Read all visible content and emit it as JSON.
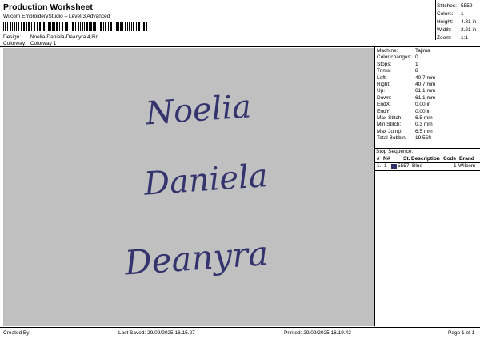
{
  "header": {
    "title": "Production Worksheet",
    "subtitle": "Wilcom EmbroideryStudio – Level 3 Advanced",
    "design_label": "Design:",
    "design_value": "Noelia-Daniela-Deanyra 4,8in",
    "colorway_label": "Colorway:",
    "colorway_value": "Colorway 1"
  },
  "summary": {
    "stitches_label": "Stitches:",
    "stitches_value": "5559",
    "colors_label": "Colors:",
    "colors_value": "1",
    "height_label": "Height:",
    "height_value": "4.81 in",
    "width_label": "Width:",
    "width_value": "3.21 in",
    "zoom_label": "Zoom:",
    "zoom_value": "1:1"
  },
  "design": {
    "names": [
      "Noelia",
      "Daniela",
      "Deanyra"
    ],
    "thread_color": "#35336e",
    "background_color": "#c0c0c0"
  },
  "machine_info": {
    "machine_label": "Machine:",
    "machine_value": "Tajima",
    "color_changes_label": "Color changes:",
    "color_changes_value": "0",
    "stops_label": "Stops:",
    "stops_value": "1",
    "trims_label": "Trims:",
    "trims_value": "8",
    "left_label": "Left:",
    "left_value": "40.7 mm",
    "right_label": "Right:",
    "right_value": "40.7 mm",
    "up_label": "Up:",
    "up_value": "61.1 mm",
    "down_label": "Down:",
    "down_value": "61.1 mm",
    "endx_label": "EndX:",
    "endx_value": "0.00 in",
    "endy_label": "EndY:",
    "endy_value": "0.00 in",
    "max_stitch_label": "Max Stitch:",
    "max_stitch_value": "6.5 mm",
    "min_stitch_label": "Min Stitch:",
    "min_stitch_value": "0.3 mm",
    "max_jump_label": "Max Jump:",
    "max_jump_value": "6.5 mm",
    "total_bobbin_label": "Total Bobbin:",
    "total_bobbin_value": "19.55ft"
  },
  "stop_sequence": {
    "title": "Stop Sequence:",
    "columns": {
      "index": "#",
      "n": "N#",
      "st": "St.",
      "description": "Description",
      "code": "Code",
      "brand": "Brand"
    },
    "rows": [
      {
        "index": "1.",
        "n": "1",
        "st": "5557",
        "description": "Blue",
        "code": "1",
        "brand": "Wilcom",
        "swatch": "#2f2f6e"
      }
    ]
  },
  "footer": {
    "created_by": "Created By:",
    "last_saved": "Last Saved: 29/09/2025 16.15.27",
    "printed": "Printed: 29/09/2025 16.19.42",
    "page": "Page 1 of 1"
  }
}
